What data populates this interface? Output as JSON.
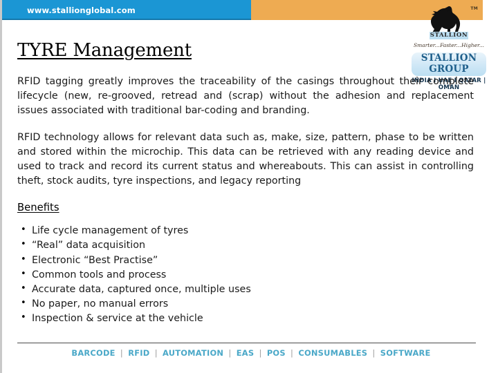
{
  "header": {
    "site_url": "www.stallionglobal.com",
    "blue_color": "#1b96d4",
    "orange_color": "#eeab52"
  },
  "logo": {
    "trademark": "TM",
    "brand_chip": "STALLION",
    "tagline": [
      "Smarter...",
      "Faster...",
      "Higher..."
    ],
    "group_name": "STALLION GROUP",
    "countries": "INDIA I UAE I QATAR | OMAN",
    "chip_color": "#bcdff2"
  },
  "slide": {
    "title": "TYRE Management",
    "paragraphs": [
      "RFID tagging greatly improves the traceability of the casings  throughout their complete lifecycle (new, re-grooved, retread and (scrap) without the adhesion and replacement issues associated with traditional bar-coding and branding.",
      "RFID technology allows for relevant data such as, make, size, pattern, phase to be written and stored within the microchip. This data can be retrieved with any reading device and used to track and record its current status and whereabouts. This can assist in controlling theft, stock audits, tyre inspections, and legacy reporting"
    ],
    "benefits_heading": "Benefits",
    "benefits": [
      "Life cycle management of tyres",
      "“Real” data acquisition",
      "Electronic “Best Practise”",
      "Common tools and process",
      "Accurate data, captured once, multiple uses",
      "No paper, no manual errors",
      "Inspection & service at the vehicle"
    ]
  },
  "footer": {
    "items": [
      "BARCODE",
      "RFID",
      "AUTOMATION",
      "EAS",
      "POS",
      "CONSUMABLES",
      "SOFTWARE"
    ],
    "separator": "|",
    "text_color": "#4aa8c8"
  }
}
